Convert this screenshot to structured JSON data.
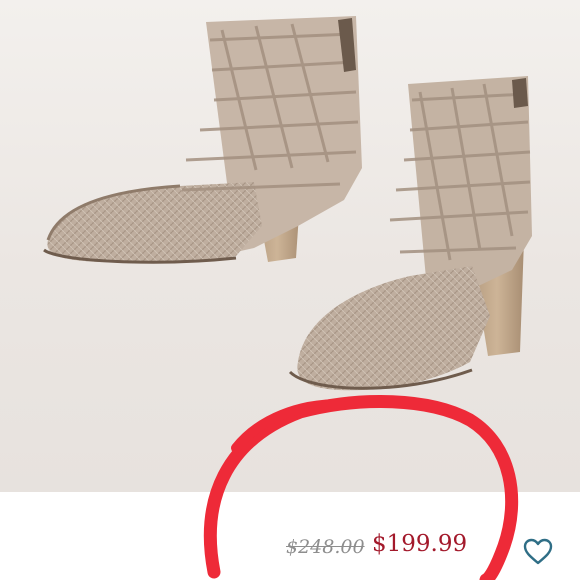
{
  "product": {
    "image_icon": "woven-leather-ankle-boots-photo",
    "price_original": "$248.00",
    "price_sale": "$199.99",
    "wishlist_icon": "heart-outline-icon"
  },
  "colors": {
    "background": "#ece8e4",
    "price_sale": "#a3192b",
    "price_original": "#8e8e8e",
    "wishlist_icon": "#2f6e86",
    "annotation_circle": "#ee2a38"
  }
}
